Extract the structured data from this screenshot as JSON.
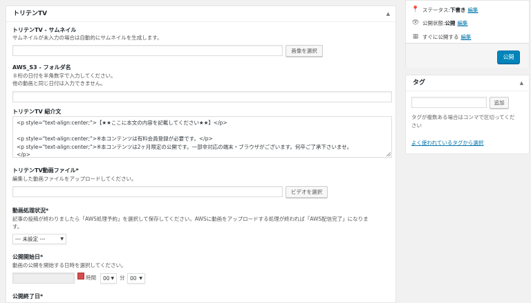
{
  "main_panel": {
    "title": "トリテンTV",
    "toggle": "▲",
    "thumbnail": {
      "label": "トリテンTV - サムネイル",
      "desc": "サムネイルが未入力の場合は自動的にサムネイルを生成します。",
      "value": "",
      "button": "画像を選択"
    },
    "aws_folder": {
      "label": "AWS_S3 - フォルダ名",
      "desc1": "８桁の日付を半角数字で入力してください。",
      "desc2": "他の動画と同じ日付は入力できません。",
      "value": ""
    },
    "intro": {
      "label": "トリテンTV 紹介文",
      "lines": [
        "<p style=\"text-align:center;\">【★★ここに本文の内容を記載してください★★】</p>",
        "",
        "<p style=\"text-align:center;\">※本コンテンツは有料会員登録が必要です。</p>",
        "<p style=\"text-align:center;\">※本コンテンツは2ヶ月限定の公開です。一部非対応の端末・ブラウザがございます。何卒ご了承下さいませ。",
        "</p>"
      ]
    },
    "video_file": {
      "label": "トリテンTV動画ファイル*",
      "desc": "編集した動画ファイルをアップロードしてください。",
      "value": "",
      "button": "ビデオを選択"
    },
    "processing": {
      "label": "動画処理状況*",
      "desc1": "記事の投稿が終わりましたら「AWS処理予約」を選択して保存してください。AWSに動画をアップロードする処理が終われば「AWS配信完了」になりま",
      "desc2": "す。",
      "selected": "--- 未設定 ---"
    },
    "start_date": {
      "label": "公開開始日*",
      "desc": "動画の公開を開始する日時を選択してください。",
      "value": "",
      "hour_label": "時間",
      "hour_value": "00",
      "min_label": "分",
      "min_value": "00"
    },
    "end_date": {
      "label": "公開終了日*"
    }
  },
  "publish_box": {
    "status_label": "ステータス:",
    "status_value": "下書き",
    "status_edit": "編集",
    "visibility_label": "公開状態:",
    "visibility_value": "公開",
    "visibility_edit": "編集",
    "schedule_label": "すぐに公開する",
    "schedule_edit": "編集",
    "publish_button": "公開"
  },
  "tag_box": {
    "title": "タグ",
    "toggle": "▲",
    "input_value": "",
    "add_button": "追加",
    "hint1": "タグが複数ある場合はコンマで区切ってくだ",
    "hint2": "さい",
    "popular_link": "よく使われているタグから選択"
  },
  "colors": {
    "accent": "#0085ba",
    "link": "#0073aa",
    "background": "#f1f1f1"
  }
}
